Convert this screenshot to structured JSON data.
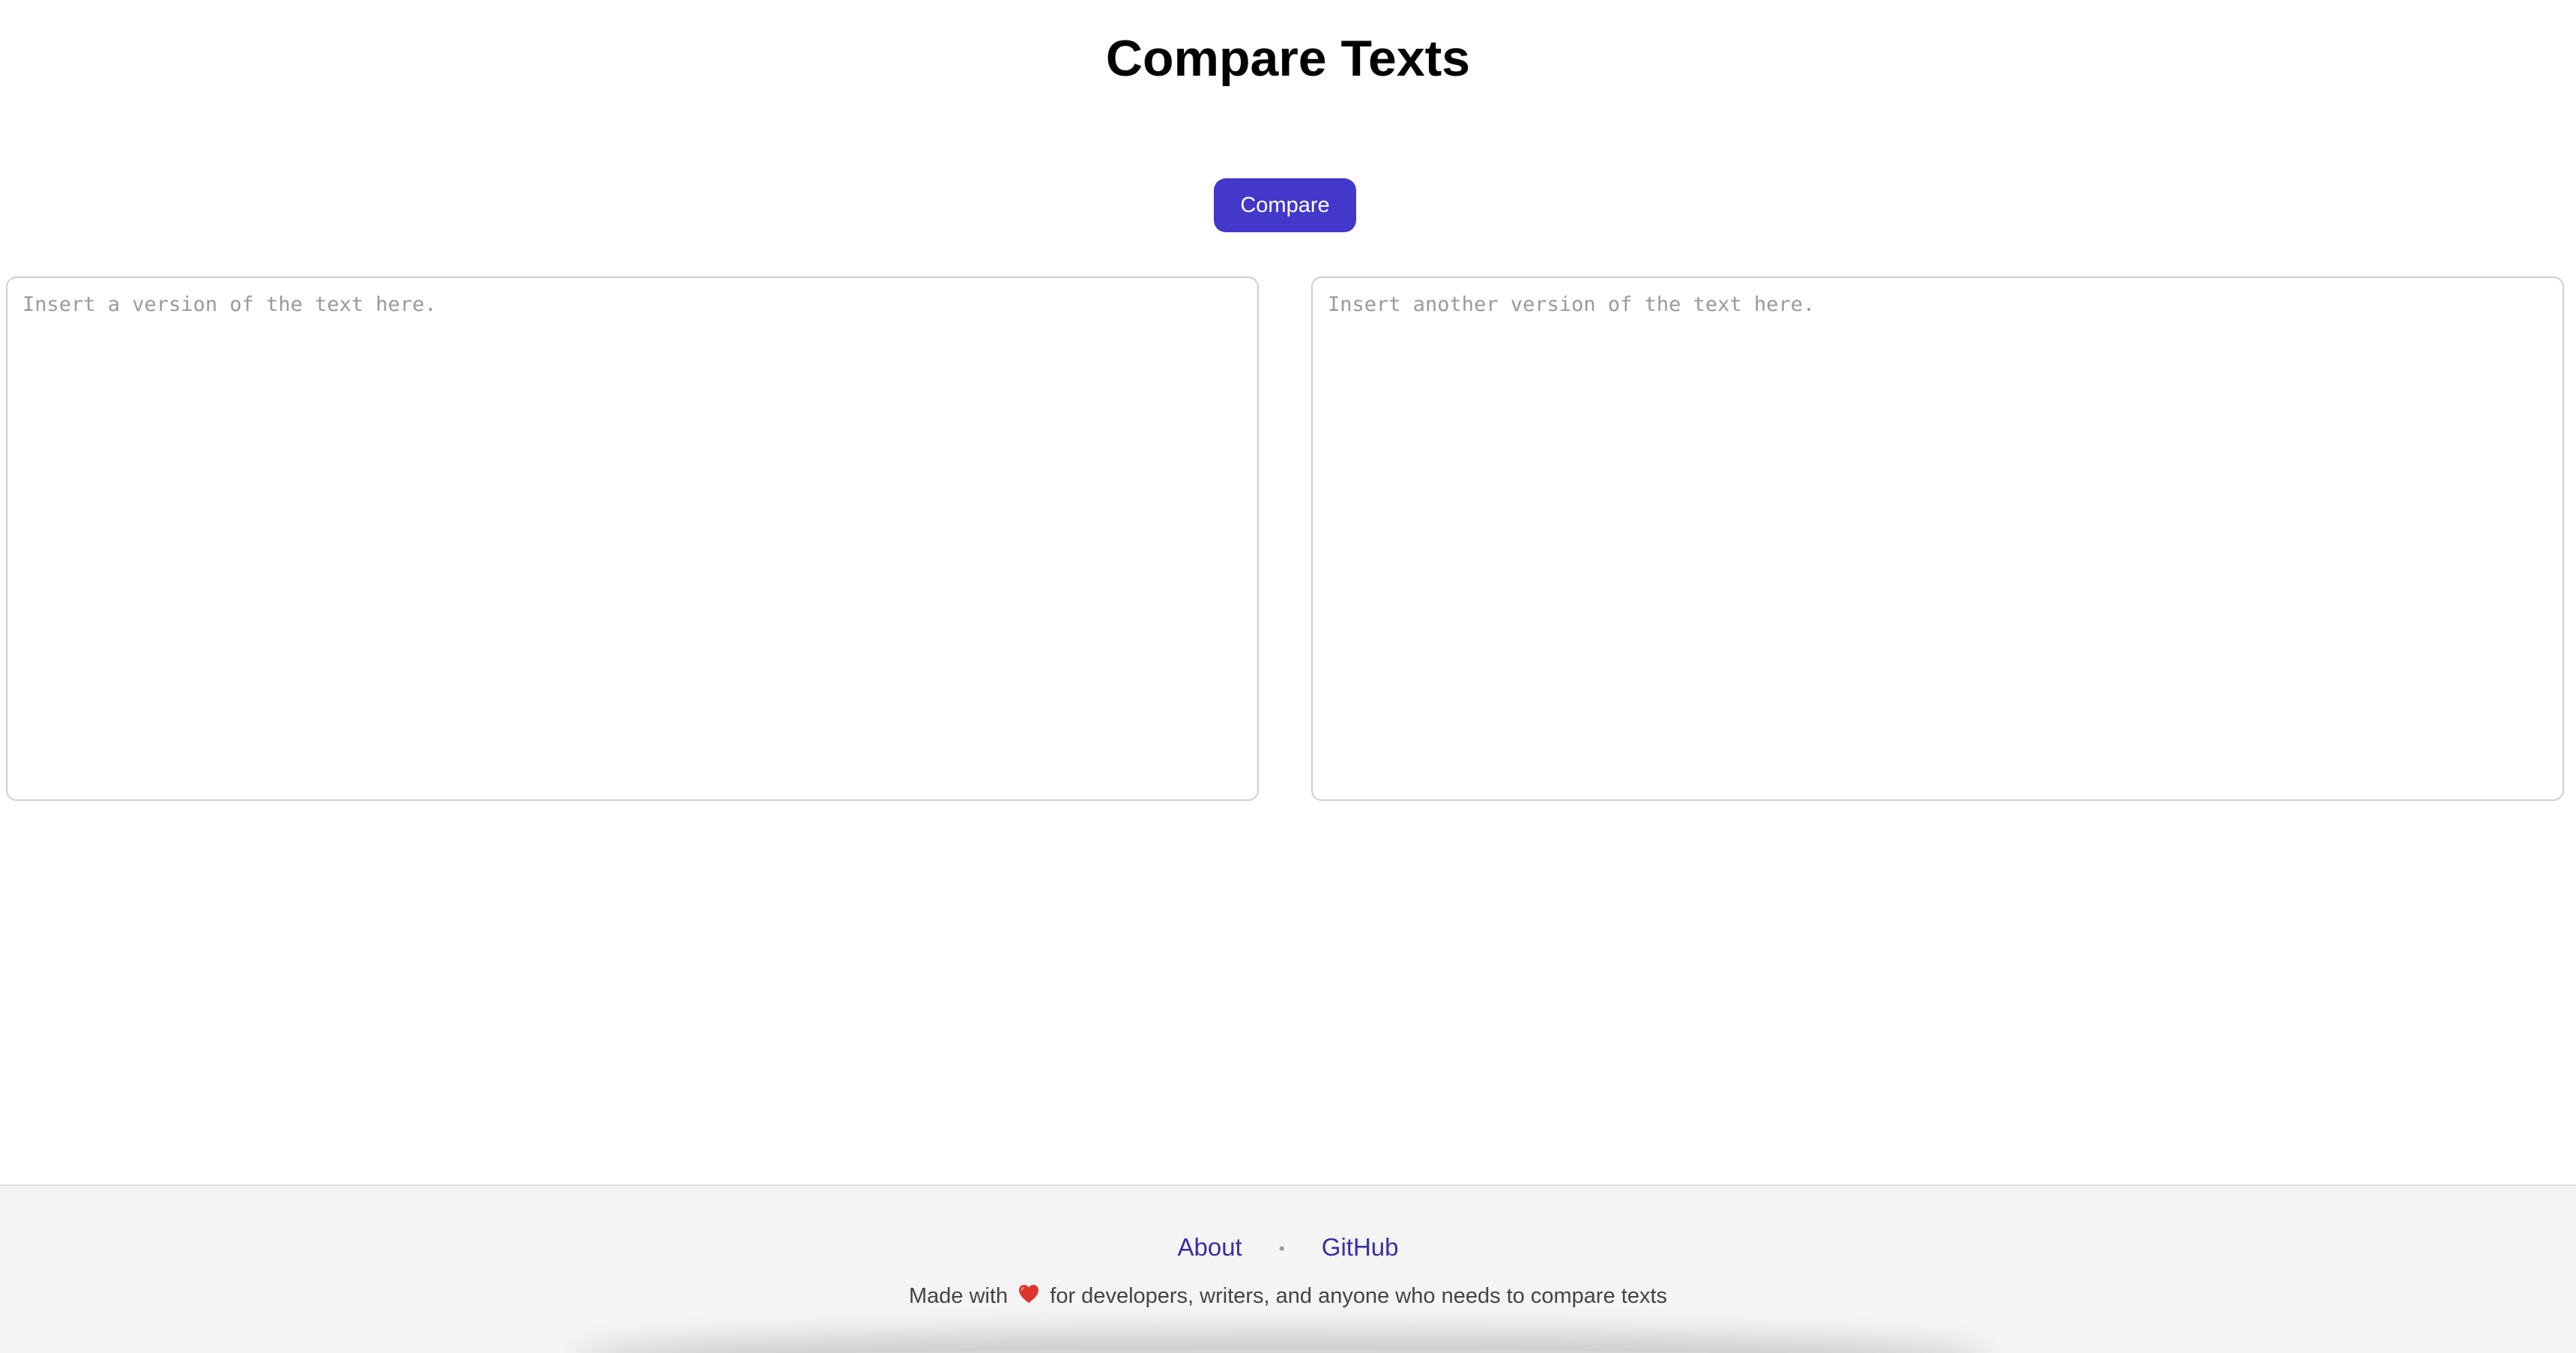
{
  "header": {
    "title": "Compare Texts"
  },
  "toolbar": {
    "compare_label": "Compare"
  },
  "editors": {
    "left_placeholder": "Insert a version of the text here.",
    "right_placeholder": "Insert another version of the text here.",
    "left_value": "",
    "right_value": ""
  },
  "footer": {
    "about_label": "About",
    "separator": "•",
    "github_label": "GitHub",
    "tagline_prefix": "Made with",
    "tagline_suffix": "for developers, writers, and anyone who needs to compare texts",
    "heart_icon": "heart-icon"
  },
  "colors": {
    "accent": "#4338ca",
    "link": "#3730a3",
    "heart": "#e0342f",
    "footer_bg": "#f4f4f4"
  }
}
